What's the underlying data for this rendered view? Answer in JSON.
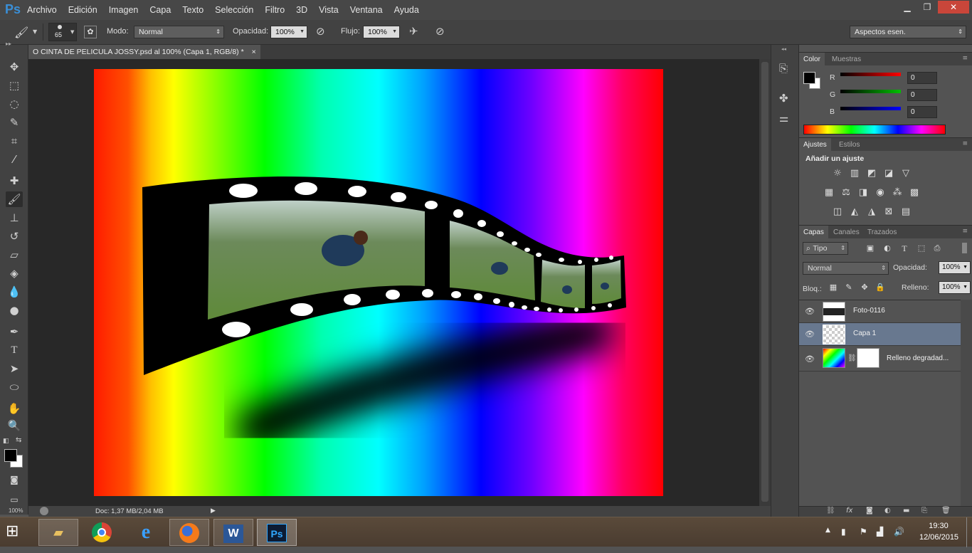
{
  "app": {
    "logo": "Ps",
    "menu": [
      "Archivo",
      "Edición",
      "Imagen",
      "Capa",
      "Texto",
      "Selección",
      "Filtro",
      "3D",
      "Vista",
      "Ventana",
      "Ayuda"
    ]
  },
  "window_controls": {
    "minimize": "▁",
    "restore": "❐",
    "close": "✕"
  },
  "options_bar": {
    "brush_size": "65",
    "mode_label": "Modo:",
    "mode_value": "Normal",
    "opacity_label": "Opacidad:",
    "opacity_value": "100%",
    "flow_label": "Flujo:",
    "flow_value": "100%",
    "workspace": "Aspectos esen."
  },
  "document": {
    "tab_title": "O CINTA DE PELICULA JOSSY.psd al 100% (Capa 1, RGB/8) *",
    "tab_close": "×",
    "zoom": "100%",
    "doc_info": "Doc: 1,37 MB/2,04 MB"
  },
  "color_panel": {
    "tabs": [
      "Color",
      "Muestras"
    ],
    "channels": [
      {
        "label": "R",
        "value": "0",
        "color": "#ff0000"
      },
      {
        "label": "G",
        "value": "0",
        "color": "#00c000"
      },
      {
        "label": "B",
        "value": "0",
        "color": "#0000ff"
      }
    ]
  },
  "adjustments_panel": {
    "tabs": [
      "Ajustes",
      "Estilos"
    ],
    "heading": "Añadir un ajuste"
  },
  "layers_panel": {
    "tabs": [
      "Capas",
      "Canales",
      "Trazados"
    ],
    "filter": "Tipo",
    "blend_mode": "Normal",
    "opacity_label": "Opacidad:",
    "opacity_value": "100%",
    "lock_label": "Bloq.:",
    "fill_label": "Relleno:",
    "fill_value": "100%",
    "layers": [
      {
        "name": "Foto-0116",
        "selected": false
      },
      {
        "name": "Capa 1",
        "selected": true
      },
      {
        "name": "Relleno degradad...",
        "selected": false
      }
    ]
  },
  "taskbar": {
    "time": "19:30",
    "date": "12/06/2015",
    "apps": [
      "file-explorer",
      "chrome",
      "internet-explorer",
      "firefox",
      "word",
      "photoshop"
    ],
    "ps_label": "Ps",
    "word_label": "W"
  }
}
